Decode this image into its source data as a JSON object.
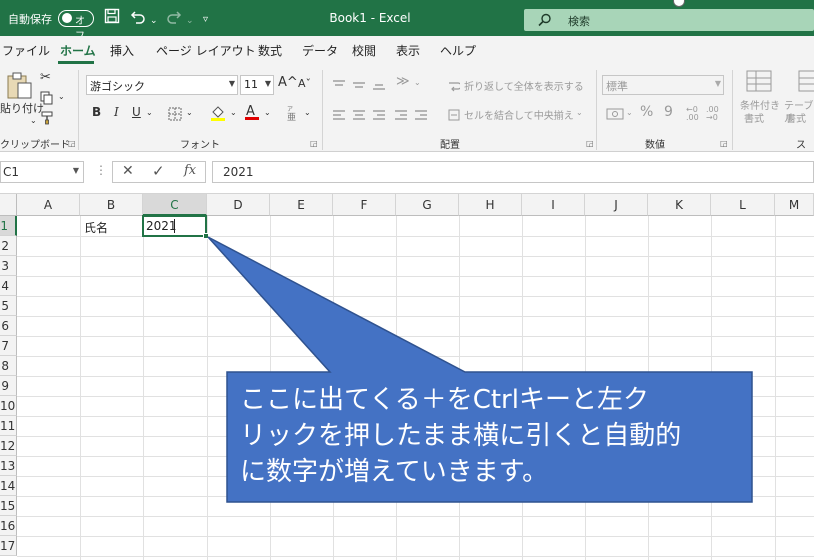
{
  "titlebar": {
    "autosave_label": "自動保存",
    "autosave_state": "オフ",
    "title": "Book1  -  Excel",
    "search_placeholder": "検索"
  },
  "tabs": [
    "ファイル",
    "ホーム",
    "挿入",
    "ページ レイアウト",
    "数式",
    "データ",
    "校閲",
    "表示",
    "ヘルプ"
  ],
  "ribbon": {
    "clipboard": {
      "paste": "貼り付け",
      "label": "クリップボード"
    },
    "font": {
      "font_name": "游ゴシック",
      "font_size": "11",
      "grow": "A^",
      "shrink": "Aˇ",
      "bold": "B",
      "italic": "I",
      "underline": "U",
      "label": "フォント"
    },
    "alignment": {
      "wrap_text": "折り返して全体を表示する",
      "merge_center": "セルを結合して中央揃え",
      "label": "配置"
    },
    "number": {
      "format": "標準",
      "label": "数値"
    },
    "styles": {
      "conditional": "条件付き",
      "conditional_sub": "書式",
      "table": "テーブル",
      "table_sub": "書式",
      "label": "スタ"
    }
  },
  "formula_bar": {
    "name_box": "C1",
    "fx": "fx",
    "content": "2021"
  },
  "grid": {
    "columns": [
      "A",
      "B",
      "C",
      "D",
      "E",
      "F",
      "G",
      "H",
      "I",
      "J",
      "K",
      "L",
      "M"
    ],
    "rows": [
      "1",
      "2",
      "3",
      "4",
      "5",
      "6",
      "7",
      "8",
      "9",
      "10",
      "11",
      "12",
      "13",
      "14",
      "15",
      "16",
      "17"
    ]
  },
  "cells": {
    "B1": "氏名",
    "C1": "2021"
  },
  "callout": {
    "text": "ここに出てくる＋をCtrlキーと左ク\nリックを押したまま横に引くと自動的\nに数字が増えていきます。"
  },
  "colors": {
    "excel_green": "#217346",
    "callout_fill": "#4472c4",
    "callout_border": "#2f528f"
  }
}
